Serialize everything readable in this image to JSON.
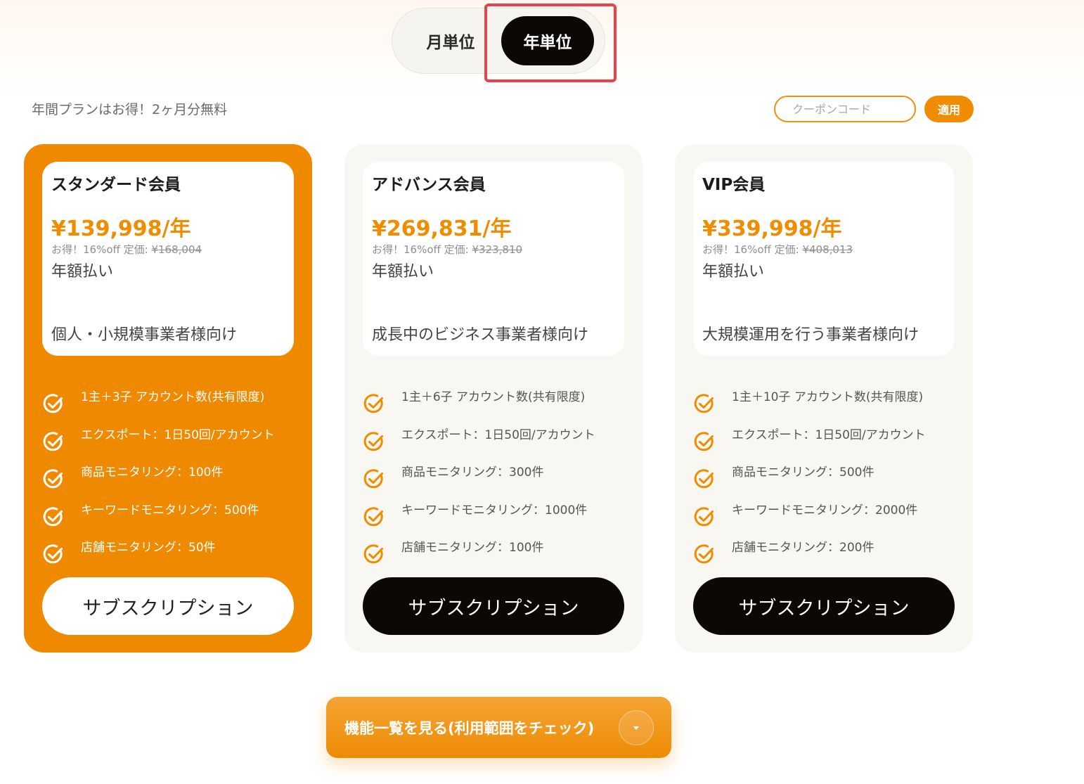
{
  "billing_toggle": {
    "monthly_label": "月単位",
    "yearly_label": "年単位",
    "selected": "yearly"
  },
  "promo_text": "年間プランはお得！2ヶ月分無料",
  "coupon": {
    "placeholder": "クーポンコード",
    "value": "",
    "apply_label": "適用"
  },
  "colors": {
    "accent": "#f08c00",
    "dark": "#0b0806",
    "highlight": "#e8424f"
  },
  "plans": [
    {
      "name": "スタンダード会員",
      "price": "¥139,998/年",
      "discount_prefix": "お得！16%off 定価: ",
      "list_price": "¥168,004",
      "billing": "年額払い",
      "target": "個人・小規模事業者様向け",
      "features": [
        "1主＋3子 アカウント数(共有限度)",
        "エクスポート：1日50回/アカウント",
        "商品モニタリング：100件",
        "キーワードモニタリング：500件",
        "店舗モニタリング：50件"
      ],
      "subscribe_label": "サブスクリプション",
      "featured": true
    },
    {
      "name": "アドバンス会員",
      "price": "¥269,831/年",
      "discount_prefix": "お得！16%off 定価: ",
      "list_price": "¥323,810",
      "billing": "年額払い",
      "target": "成長中のビジネス事業者様向け",
      "features": [
        "1主＋6子 アカウント数(共有限度)",
        "エクスポート：1日50回/アカウント",
        "商品モニタリング：300件",
        "キーワードモニタリング：1000件",
        "店舗モニタリング：100件"
      ],
      "subscribe_label": "サブスクリプション",
      "featured": false
    },
    {
      "name": "VIP会員",
      "price": "¥339,998/年",
      "discount_prefix": "お得！16%off 定価: ",
      "list_price": "¥408,013",
      "billing": "年額払い",
      "target": "大規模運用を行う事業者様向け",
      "features": [
        "1主＋10子 アカウント数(共有限度)",
        "エクスポート：1日50回/アカウント",
        "商品モニタリング：500件",
        "キーワードモニタリング：2000件",
        "店舗モニタリング：200件"
      ],
      "subscribe_label": "サブスクリプション",
      "featured": false
    }
  ],
  "features_button": {
    "label": "機能一覧を見る(利用範囲をチェック)",
    "icon": "chevron-down-icon"
  }
}
